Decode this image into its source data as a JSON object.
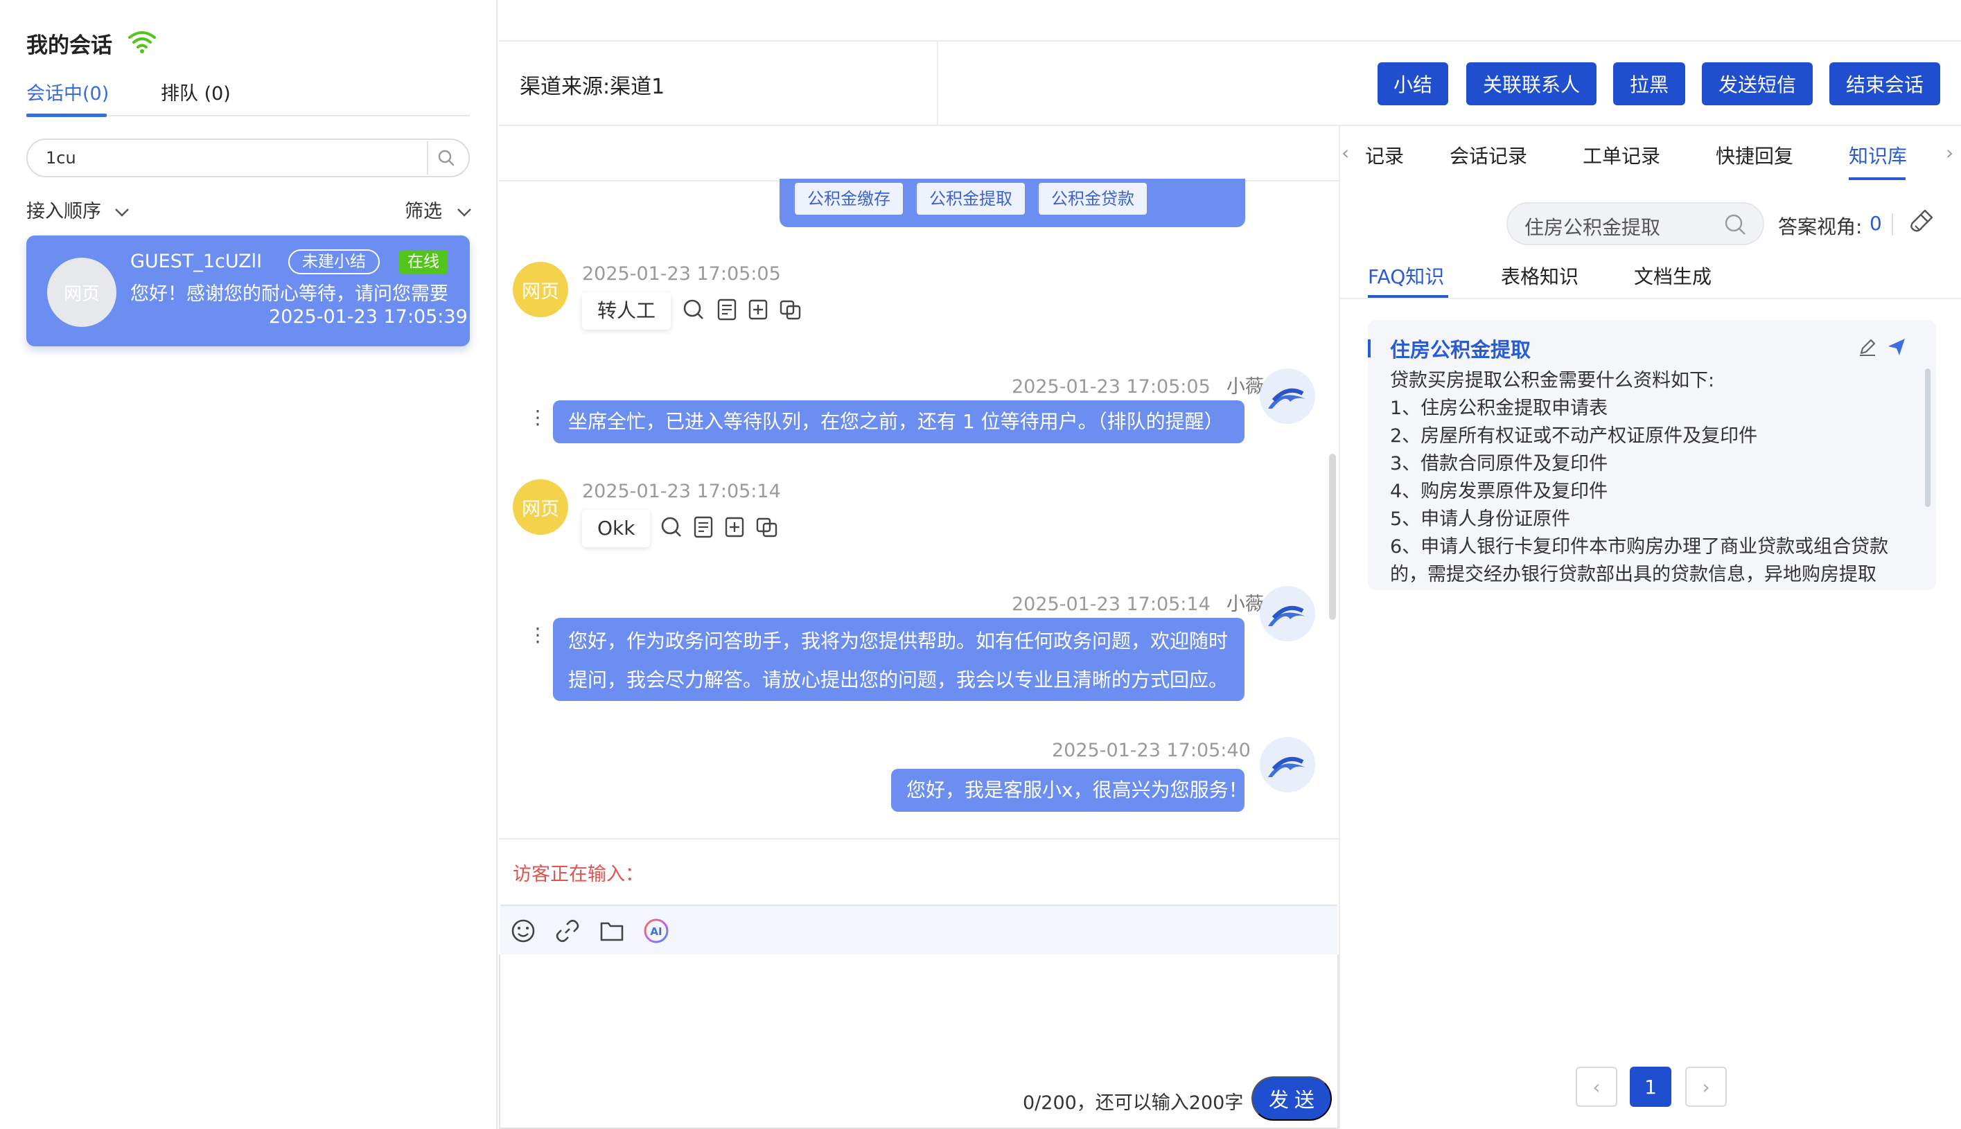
{
  "left": {
    "title": "我的会话",
    "tabs": [
      {
        "label": "会话中(0)",
        "active": true
      },
      {
        "label": "排队 (0)",
        "active": false
      }
    ],
    "search": {
      "value": "1cu"
    },
    "sort_label": "接入顺序",
    "filter_label": "筛选",
    "conversations": [
      {
        "avatar_text": "网页",
        "name": "GUEST_1cUZlI",
        "status_badge": "未建小结",
        "online_badge": "在线",
        "last_message": "您好！感谢您的耐心等待，请问您需要",
        "time": "2025-01-23 17:05:39"
      }
    ]
  },
  "header": {
    "channel": "渠道来源:渠道1",
    "buttons": [
      "小结",
      "关联联系人",
      "拉黑",
      "发送短信",
      "结束会话"
    ]
  },
  "chat": {
    "quick_chips": [
      "公积金缴存",
      "公积金提取",
      "公积金贷款"
    ],
    "messages": [
      {
        "from": "guest",
        "avatar_text": "网页",
        "time": "2025-01-23 17:05:05",
        "text": "转人工"
      },
      {
        "from": "agent",
        "time": "2025-01-23 17:05:05",
        "name": "小薇",
        "lines": [
          "坐席全忙，已进入等待队列，在您之前，还有 1 位等待用户。（排队的提醒）"
        ]
      },
      {
        "from": "guest",
        "avatar_text": "网页",
        "time": "2025-01-23 17:05:14",
        "text": "Okk"
      },
      {
        "from": "agent",
        "time": "2025-01-23 17:05:14",
        "name": "小薇",
        "lines": [
          "您好，作为政务问答助手，我将为您提供帮助。如有任何政务问题，欢迎随时",
          "提问，我会尽力解答。请放心提出您的问题，我会以专业且清晰的方式回应。"
        ]
      },
      {
        "from": "agent",
        "time": "2025-01-23 17:05:40",
        "name": "",
        "lines": [
          "您好，我是客服小x，很高兴为您服务！"
        ]
      }
    ],
    "typing_text": "访客正在输入：",
    "counter": "0/200，还可以输入200字",
    "send_label": "发 送",
    "toolbar_icons": [
      "emoji-icon",
      "link-icon",
      "folder-icon",
      "ai-icon"
    ]
  },
  "right": {
    "tabs": [
      "记录",
      "会话记录",
      "工单记录",
      "快捷回复",
      "知识库"
    ],
    "active_tab": "知识库",
    "search": {
      "value": "住房公积金提取"
    },
    "answer_view_label": "答案视角:",
    "answer_view_count": "0",
    "subtabs": [
      "FAQ知识",
      "表格知识",
      "文档生成"
    ],
    "faq": {
      "title": "住房公积金提取",
      "lines": [
        "贷款买房提取公积金需要什么资料如下:",
        "1、住房公积金提取申请表",
        "2、房屋所有权证或不动产权证原件及复印件",
        "3、借款合同原件及复印件",
        "4、购房发票原件及复印件",
        "5、申请人身份证原件",
        "6、申请人银行卡复印件本市购房办理了商业贷款或组合贷款",
        "的，需提交经办银行贷款部出具的贷款信息，异地购房提取"
      ]
    },
    "pagination": {
      "current": "1",
      "prev": "‹",
      "next": "›"
    }
  },
  "colors": {
    "primary": "#1f4fcf",
    "bubble": "#6b8ef0",
    "online": "#52c41a",
    "typing": "#e0534f",
    "avatar_guest": "#f5d24b"
  }
}
